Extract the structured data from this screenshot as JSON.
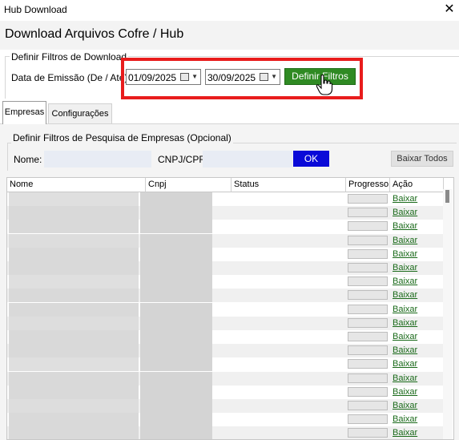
{
  "window": {
    "title": "Hub Download",
    "close_glyph": "✕"
  },
  "heading": "Download Arquivos Cofre / Hub",
  "filters": {
    "group_title": "Definir Filtros de Download",
    "date_label": "Data de Emissão (De / Até):",
    "date_from": "01/09/2025",
    "date_to": "30/09/2025",
    "apply_label": "Definir Filtros"
  },
  "tabs": [
    {
      "label": "Empresas",
      "active": true
    },
    {
      "label": "Configurações",
      "active": false
    }
  ],
  "search": {
    "group_title": "Definir Filtros de Pesquisa de Empresas (Opcional)",
    "nome_label": "Nome:",
    "nome_value": "",
    "cnpj_label": "CNPJ/CPF:",
    "cnpj_value": "",
    "ok_label": "OK",
    "baixar_todos_label": "Baixar Todos"
  },
  "grid": {
    "columns": [
      "Nome",
      "Cnpj",
      "Status",
      "Progresso",
      "Ação"
    ],
    "row_action_label": "Baixar",
    "row_count": 18
  },
  "colors": {
    "apply_button": "#2f8a23",
    "ok_button": "#0a0ad8",
    "highlight": "#e81c1c",
    "link": "#1a6a1a"
  },
  "icons": [
    "close-icon",
    "calendar-icon",
    "chevron-down-icon",
    "hand-pointer-icon"
  ]
}
